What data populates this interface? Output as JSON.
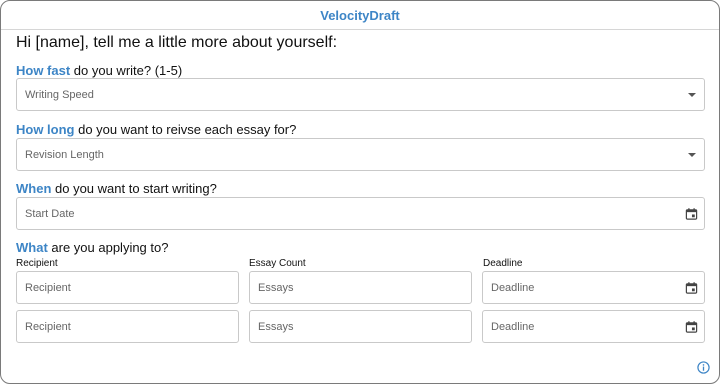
{
  "app": {
    "title": "VelocityDraft"
  },
  "greeting": "Hi [name], tell me a little more about yourself:",
  "questions": {
    "speed": {
      "highlight": "How fast",
      "rest": " do you write? (1-5)",
      "placeholder": "Writing Speed"
    },
    "revision": {
      "highlight": "How long",
      "rest": " do you want to reivse each essay for?",
      "placeholder": "Revision Length"
    },
    "start": {
      "highlight": "When",
      "rest": " do you want to start writing?",
      "placeholder": "Start Date"
    },
    "applying": {
      "highlight": "What",
      "rest": " are you applying to?"
    }
  },
  "table": {
    "columns": [
      "Recipient",
      "Essay Count",
      "Deadline"
    ],
    "rows": [
      {
        "recipient": "Recipient",
        "essays": "Essays",
        "deadline": "Deadline"
      },
      {
        "recipient": "Recipient",
        "essays": "Essays",
        "deadline": "Deadline"
      }
    ]
  },
  "icons": {
    "dropdown": "chevron-down-icon",
    "calendar": "calendar-icon",
    "info": "info-icon"
  },
  "colors": {
    "accent": "#3d85c6"
  }
}
